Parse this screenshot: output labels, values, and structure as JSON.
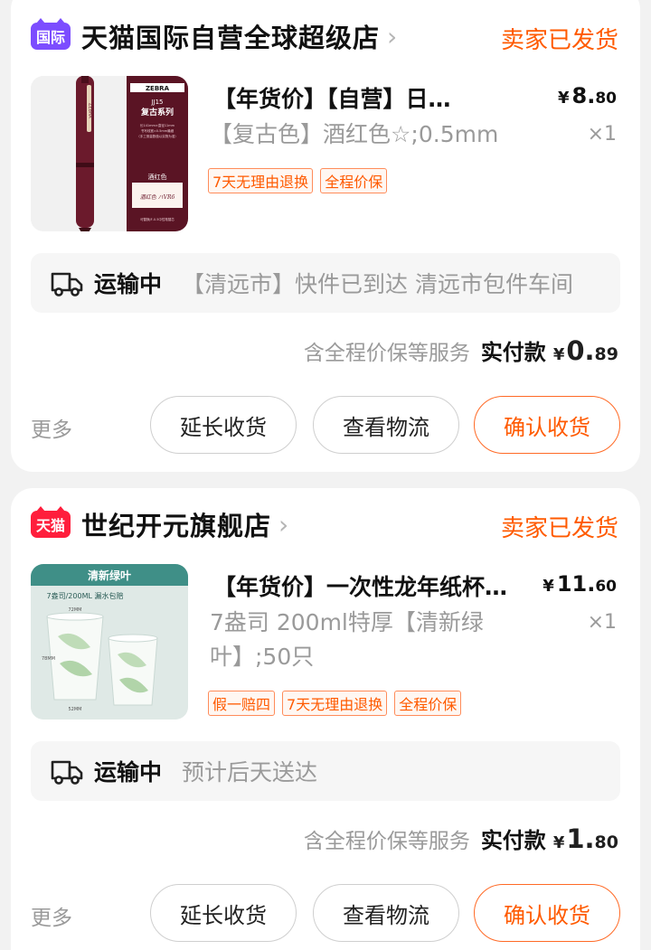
{
  "orders": [
    {
      "store_badge": "国际",
      "store_name": "天猫国际自营全球超级店",
      "store_chevron": "›",
      "status": "卖家已发货",
      "product": {
        "title": "【年货价】【自营】日…",
        "sku": "【复古色】酒红色☆;0.5mm",
        "price_yen": "¥",
        "price_int": "8.",
        "price_dec": "80",
        "qty": "×1",
        "tags": [
          "7天无理由退换",
          "全程价保"
        ],
        "image_text": {
          "brand": "ZEBRA",
          "model": "JJ15",
          "series": "复古系列",
          "spec1": "长141mm×直径11mm",
          "spec2": "书写线宽≈0.5mm最细",
          "spec3": "（手工测量数值以实物为准）",
          "color_name": "酒红色",
          "handwriting": "酒红色 ハVR6",
          "refill": "可替换JF-0.5中性笔替芯"
        }
      },
      "logistics": {
        "icon": "truck-icon",
        "status": "运输中",
        "detail": "【清远市】快件已到达 清远市包件车间"
      },
      "payment": {
        "service": "含全程价保等服务",
        "label": "实付款",
        "yen": "¥",
        "int": "0.",
        "dec": "89"
      },
      "actions": {
        "more": "更多",
        "extend": "延长收货",
        "logistics": "查看物流",
        "confirm": "确认收货"
      }
    },
    {
      "store_badge": "天猫",
      "store_name": "世纪开元旗舰店",
      "store_chevron": "›",
      "status": "卖家已发货",
      "product": {
        "title": "【年货价】一次性龙年纸杯…",
        "sku": "7盎司 200ml特厚【清新绿叶】;50只",
        "price_yen": "¥",
        "price_int": "11.",
        "price_dec": "60",
        "qty": "×1",
        "tags": [
          "假一赔四",
          "7天无理由退换",
          "全程价保"
        ],
        "image_text": {
          "banner": "清新绿叶",
          "subtitle": "7盎司/200ML 漏水包赔",
          "dim_top": "72MM",
          "dim_side": "78MM",
          "dim_bottom": "52MM"
        }
      },
      "logistics": {
        "icon": "truck-icon",
        "status": "运输中",
        "detail": "预计后天送达"
      },
      "payment": {
        "service": "含全程价保等服务",
        "label": "实付款",
        "yen": "¥",
        "int": "1.",
        "dec": "80"
      },
      "actions": {
        "more": "更多",
        "extend": "延长收货",
        "logistics": "查看物流",
        "confirm": "确认收货"
      }
    }
  ],
  "colors": {
    "accent": "#ff5a00",
    "intl_badge": "#7c4dff",
    "tmall_badge": "#ff1e3c",
    "pen_burgundy": "#6b1a2c"
  }
}
